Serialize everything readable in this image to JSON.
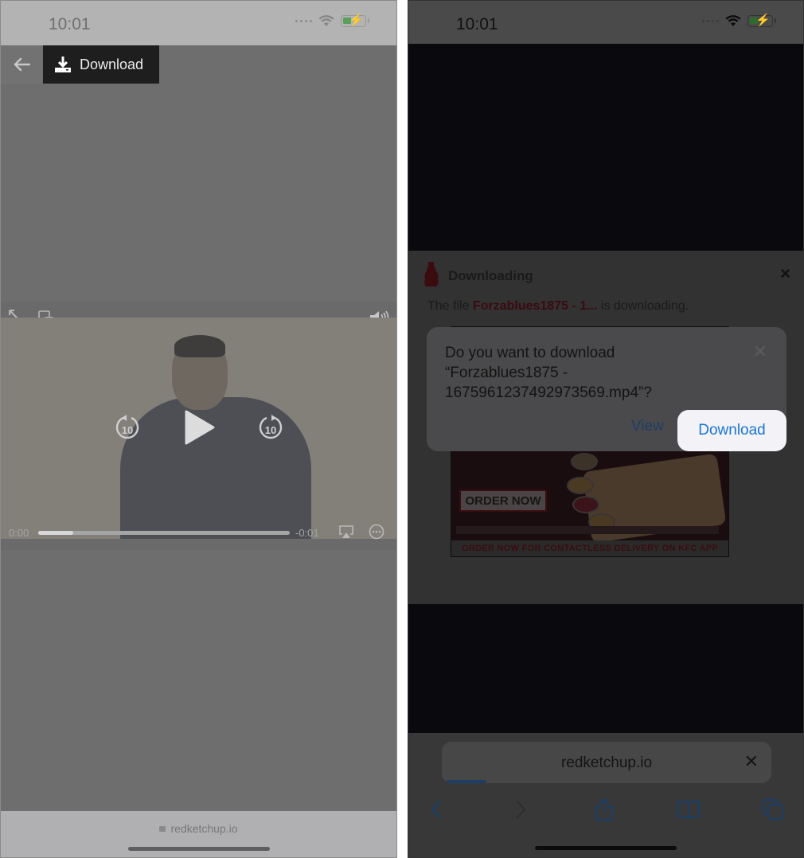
{
  "left_screen": {
    "status_bar": {
      "time": "10:01"
    },
    "toolbar": {
      "back_icon": "arrow-left-icon",
      "download_label": "Download",
      "download_icon": "download-tray-icon"
    },
    "video_player": {
      "icons": {
        "fullscreen": "expand-arrows-icon",
        "pip": "picture-in-picture-icon",
        "volume": "speaker-volume-icon",
        "skip_back": "rewind-10-icon",
        "play": "play-icon",
        "skip_forward": "forward-10-icon",
        "airplay": "airplay-icon",
        "more": "more-ellipsis-icon"
      },
      "skip_back_label": "10",
      "skip_forward_label": "10",
      "elapsed": "0:00",
      "remaining": "-0:01",
      "progress_fraction": 0.14
    },
    "address_bar": {
      "url": "redketchup.io",
      "lock_icon": "lock-icon"
    }
  },
  "right_screen": {
    "status_bar": {
      "time": "10:01"
    },
    "download_panel": {
      "title": "Downloading",
      "logo_icon": "ketchup-bottle-icon",
      "close_label": "×",
      "message_prefix": "The file ",
      "message_filename": "Forzablues1875 - 1...",
      "message_suffix": "  is downloading."
    },
    "ad": {
      "cta": "ORDER NOW",
      "banner": "ORDER NOW FOR CONTACTLESS DELIVERY ON KFC APP"
    },
    "dialog": {
      "question_line1": "Do you want to download",
      "question_line2": "“Forzablues1875 -",
      "question_line3": "1675961237492973569.mp4”?",
      "close_label": "✕",
      "view_label": "View",
      "download_label": "Download",
      "accent_color": "#1877d4"
    },
    "address_bar": {
      "url": "redketchup.io",
      "clear_label": "✕",
      "load_progress_fraction": 0.12
    },
    "nav": {
      "back_icon": "chevron-left-icon",
      "forward_icon": "chevron-right-icon",
      "share_icon": "share-icon",
      "bookmarks_icon": "book-icon",
      "tabs_icon": "tabs-icon"
    }
  }
}
